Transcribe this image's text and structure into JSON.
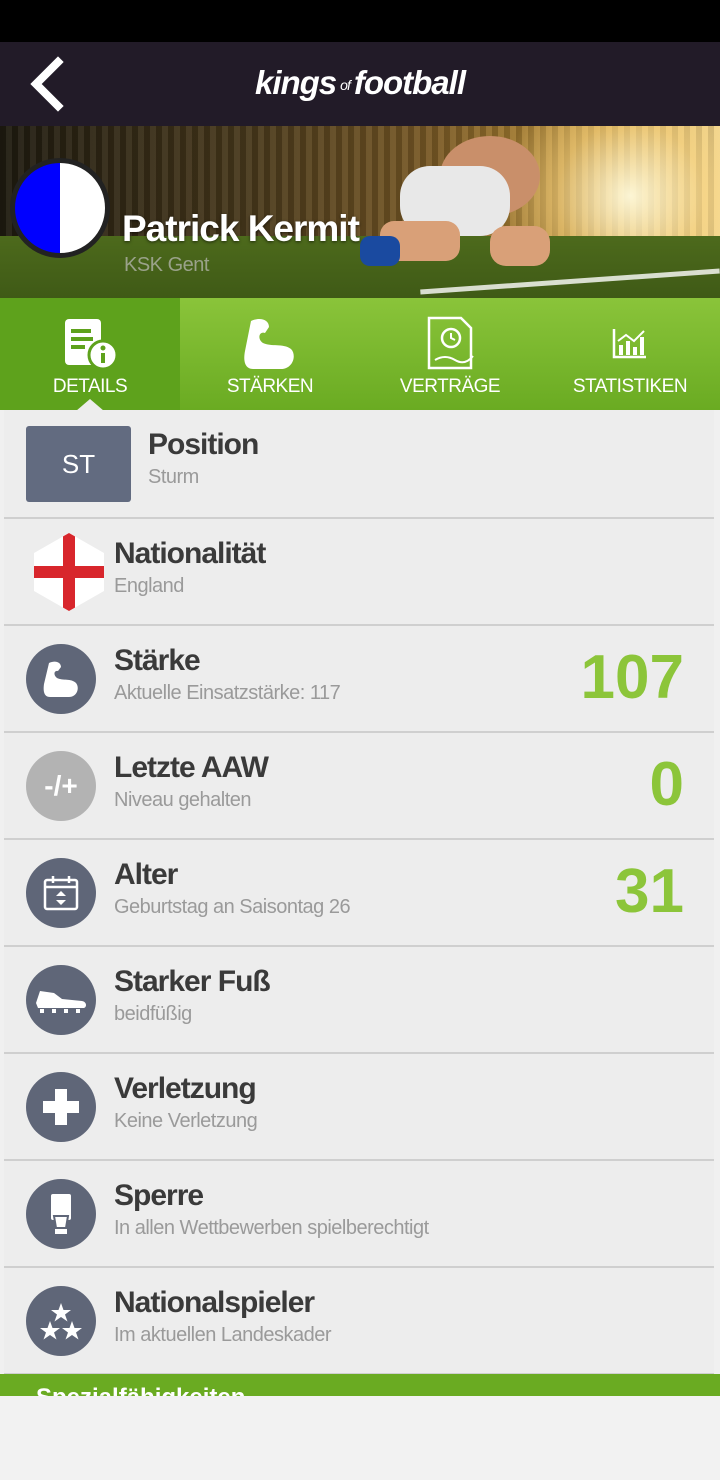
{
  "header": {
    "logo_main_1": "kings",
    "logo_of": "of",
    "logo_main_2": "football"
  },
  "player": {
    "name": "Patrick Kermit",
    "club": "KSK Gent",
    "crest_colors": [
      "#0000ff",
      "#ffffff"
    ]
  },
  "tabs": [
    {
      "label": "DETAILS",
      "icon": "details-icon",
      "active": true
    },
    {
      "label": "STÄRKEN",
      "icon": "muscle-icon",
      "active": false
    },
    {
      "label": "VERTRÄGE",
      "icon": "contract-icon",
      "active": false
    },
    {
      "label": "STATISTIKEN",
      "icon": "stats-chart-icon",
      "active": false
    }
  ],
  "rows": {
    "position": {
      "badge": "ST",
      "title": "Position",
      "sub": "Sturm"
    },
    "nationality": {
      "title": "Nationalität",
      "sub": "England",
      "icon": "england-flag-icon"
    },
    "strength": {
      "title": "Stärke",
      "sub": "Aktuelle Einsatzstärke: 117",
      "value": "107",
      "icon": "muscle-icon"
    },
    "last_aaw": {
      "title": "Letzte AAW",
      "sub": "Niveau gehalten",
      "value": "0",
      "icon_text": "-/+"
    },
    "age": {
      "title": "Alter",
      "sub": "Geburtstag an Saisontag 26",
      "value": "31",
      "icon": "calendar-icon"
    },
    "foot": {
      "title": "Starker Fuß",
      "sub": "beidfüßig",
      "icon": "football-boot-icon"
    },
    "injury": {
      "title": "Verletzung",
      "sub": "Keine Verletzung",
      "icon": "cross-icon"
    },
    "suspension": {
      "title": "Sperre",
      "sub": "In allen Wettbewerben spielberechtigt",
      "icon": "card-hand-icon"
    },
    "national": {
      "title": "Nationalspieler",
      "sub": "Im aktuellen Landeskader",
      "icon": "stars-icon"
    }
  },
  "special": {
    "label": "Spezialfähigkeiten"
  },
  "colors": {
    "accent_green": "#8cc53a",
    "tab_green": "#6aab22",
    "header_dark": "#221b28",
    "icon_slate": "#5f6678"
  }
}
